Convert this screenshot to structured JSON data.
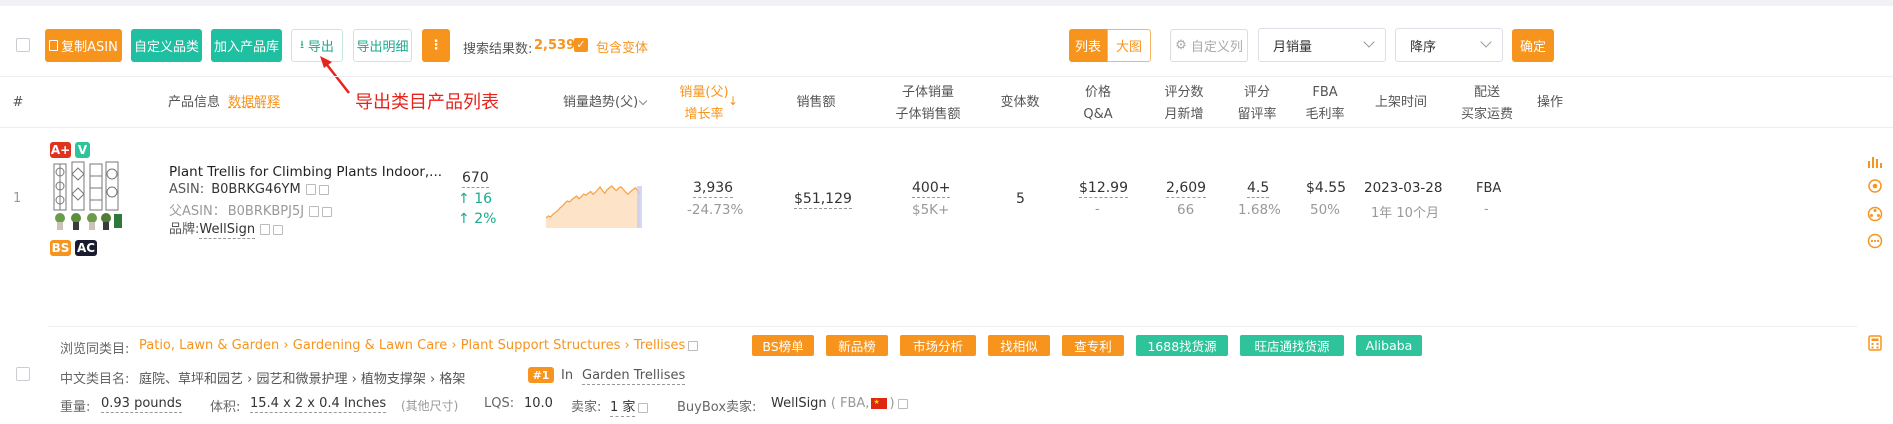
{
  "toolbar": {
    "copy_asin": "复制ASIN",
    "custom_category": "自定义品类",
    "add_to_library": "加入产品库",
    "export": "导出",
    "export_detail": "导出明细",
    "more": "⋮",
    "result_label": "搜索结果数:",
    "result_count": "2,539",
    "include_variants": "包含变体",
    "view_list": "列表",
    "view_grid": "大图",
    "custom_columns": "自定义列",
    "sort_field": "月销量",
    "sort_order": "降序",
    "confirm": "确定"
  },
  "annotation": {
    "text": "导出类目产品列表",
    "color": "#e8231b"
  },
  "columns": {
    "index": "#",
    "product_info": "产品信息",
    "data_explain": "数据解释",
    "sales_trend": "销量趋势(父)",
    "sales_parent": "销量(父)",
    "growth_rate": "增长率",
    "revenue": "销售额",
    "child_sales": "子体销量",
    "child_revenue": "子体销售额",
    "variant_count": "变体数",
    "price": "价格",
    "qa": "Q&A",
    "rating_count": "评分数",
    "monthly_new": "月新增",
    "rating": "评分",
    "review_rate": "留评率",
    "fba": "FBA",
    "margin": "毛利率",
    "listing_date": "上架时间",
    "shipping": "配送",
    "buyer_shipping": "买家运费",
    "actions": "操作"
  },
  "row": {
    "index": "1",
    "badges": {
      "aplus": "A+",
      "v": "V",
      "bs": "BS",
      "ac": "AC"
    },
    "title": "Plant Trellis for Climbing Plants Indoor,...",
    "asin_label": "ASIN:",
    "asin": "B0BRKG46YM",
    "parent_asin_label": "父ASIN：",
    "parent_asin": "B0BRKBPJ5J",
    "brand_label": "品牌:",
    "brand": "WellSign",
    "rank_value": "670",
    "rank_change": "16",
    "rank_change_pct": "2%",
    "sales": "3,936",
    "growth": "-24.73%",
    "revenue": "$51,129",
    "child_sales": "400+",
    "child_revenue": "$5K+",
    "variants": "5",
    "price": "$12.99",
    "qa": "-",
    "rating_count": "2,609",
    "monthly_new": "66",
    "rating": "4.5",
    "review_rate": "1.68%",
    "fba_fee": "$4.55",
    "margin": "50%",
    "date": "2023-03-28",
    "age": "1年 10个月",
    "shipping": "FBA",
    "buyer_shipping": "-",
    "trend": [
      18,
      22,
      20,
      26,
      30,
      34,
      40,
      44,
      50,
      55,
      53,
      58,
      62,
      66,
      60,
      64,
      70,
      68,
      72,
      76,
      70,
      74,
      80,
      86,
      78,
      72,
      80,
      84,
      88,
      82,
      78,
      84,
      86,
      80,
      74,
      70,
      76,
      80,
      84,
      78,
      72
    ]
  },
  "detail": {
    "browse_label": "浏览同类目:",
    "crumbs": [
      "Patio, Lawn & Garden",
      "Gardening & Lawn Care",
      "Plant Support Structures",
      "Trellises"
    ],
    "tags_orange": [
      "BS榜单",
      "新品榜",
      "市场分析",
      "找相似",
      "查专利"
    ],
    "tags_green": [
      "1688找货源",
      "旺店通找货源",
      "Alibaba"
    ],
    "cn_label": "中文类目名:",
    "cn_crumbs": "庭院、草坪和园艺 › 园艺和微景护理 › 植物支撑架 › 格架",
    "rank_badge": "#1",
    "rank_in": "In",
    "rank_category": "Garden Trellises",
    "weight_label": "重量:",
    "weight": "0.93 pounds",
    "size_label": "体积:",
    "size": "15.4 x 2 x 0.4 Inches",
    "size_other": "(其他尺寸)",
    "lqs_label": "LQS:",
    "lqs": "10.0",
    "seller_label": "卖家:",
    "seller": "1 家",
    "buybox_label": "BuyBox卖家:",
    "buybox": "WellSign",
    "buybox_type": "( FBA,",
    "buybox_close": ")"
  },
  "colors": {
    "orange": "#f7941d",
    "green": "#1fc0a1",
    "red": "#e8231b"
  }
}
